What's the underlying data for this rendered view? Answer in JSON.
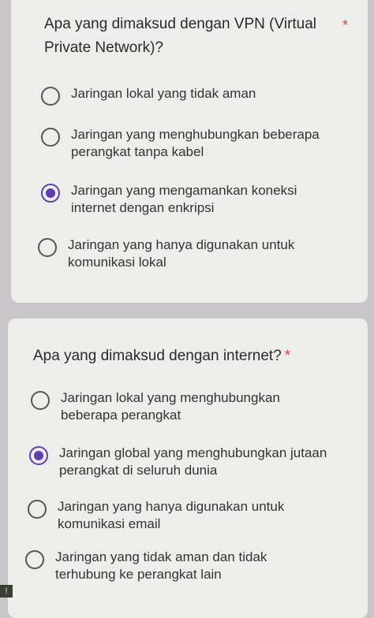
{
  "questions": [
    {
      "text": "Apa yang dimaksud dengan VPN (Virtual Private Network)?",
      "required_mark": "*",
      "options": [
        {
          "label": "Jaringan lokal yang tidak aman",
          "selected": false
        },
        {
          "label": "Jaringan yang menghubungkan beberapa perangkat tanpa kabel",
          "selected": false
        },
        {
          "label": "Jaringan yang mengamankan koneksi internet dengan enkripsi",
          "selected": true
        },
        {
          "label": "Jaringan yang hanya digunakan untuk komunikasi lokal",
          "selected": false
        }
      ]
    },
    {
      "text": "Apa yang dimaksud dengan internet?",
      "required_mark": "*",
      "options": [
        {
          "label": "Jaringan lokal yang menghubungkan beberapa perangkat",
          "selected": false
        },
        {
          "label": "Jaringan global yang menghubungkan jutaan perangkat di seluruh dunia",
          "selected": true
        },
        {
          "label": "Jaringan yang hanya digunakan untuk komunikasi email",
          "selected": false
        },
        {
          "label": "Jaringan yang tidak aman dan tidak terhubung ke perangkat lain",
          "selected": false
        }
      ]
    }
  ],
  "theme": {
    "accent": "#5f3fb0",
    "required": "#d6453a",
    "card": "#ededec",
    "background": "#c9c6c9"
  },
  "badge": {
    "icon": "notification-icon",
    "glyph": "!"
  }
}
